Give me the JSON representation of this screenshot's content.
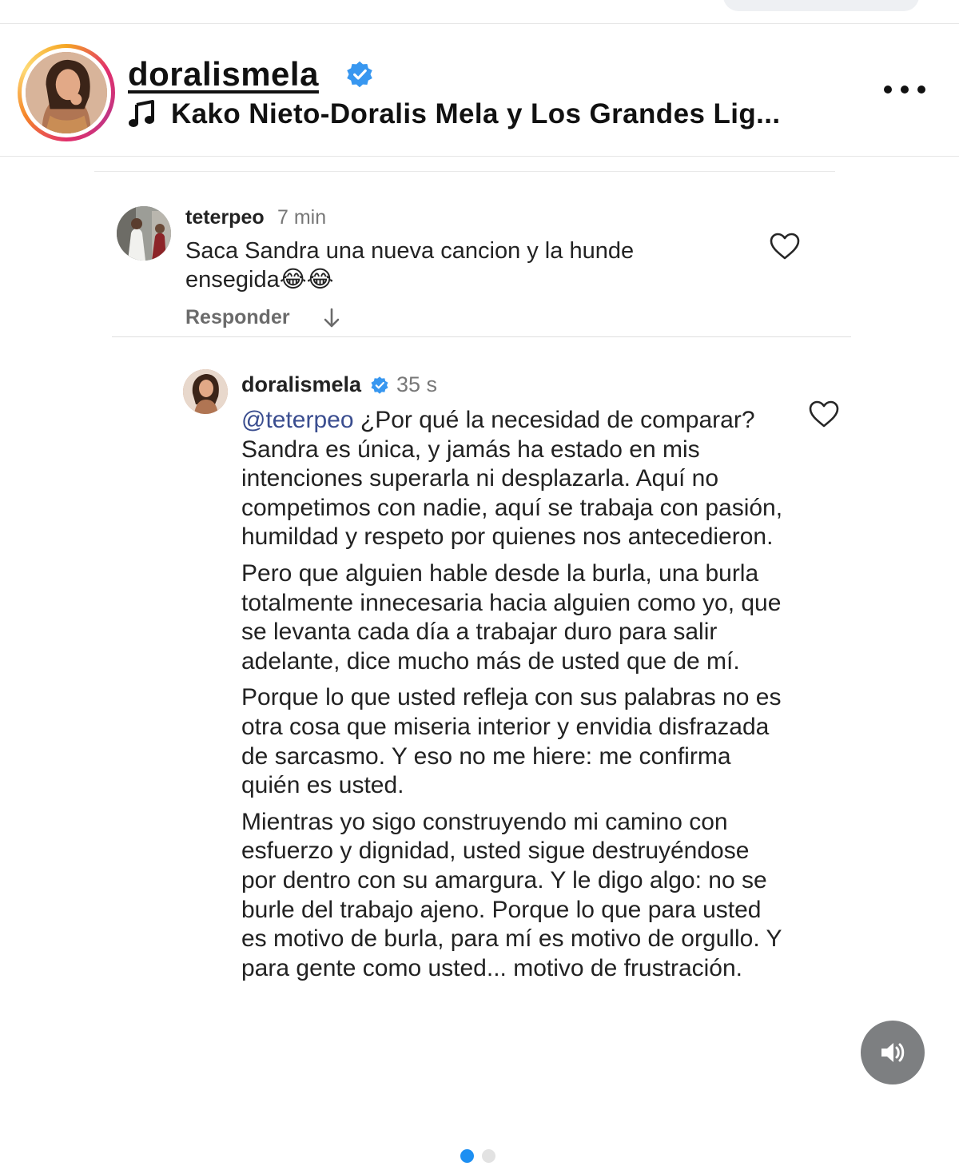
{
  "header": {
    "username": "doralismela",
    "verified": true,
    "audio_track": "Kako Nieto-Doralis Mela y Los Grandes Lig...",
    "more_icon": "more-horizontal-icon"
  },
  "comments": [
    {
      "username": "teterpeo",
      "time": "7 min",
      "text": "Saca Sandra una nueva cancion y la hunde ensegida😂😂",
      "reply_label": "Responder",
      "like_icon": "heart-outline-icon"
    },
    {
      "username": "doralismela",
      "verified": true,
      "time": "35 s",
      "mention": "@teterpeo",
      "paragraphs": [
        "¿Por qué la necesidad de comparar? Sandra es única, y jamás ha estado en mis intenciones superarla ni desplazarla. Aquí no competimos con nadie, aquí se trabaja con pasión, humildad y respeto por quienes nos antecedieron.",
        "Pero que alguien hable desde la burla, una burla totalmente innecesaria hacia alguien como yo, que se levanta cada día a trabajar duro para salir adelante, dice mucho más de usted que de mí.",
        "Porque lo que usted refleja con sus palabras no es otra cosa que miseria interior y envidia disfrazada de sarcasmo. Y eso no me hiere: me confirma quién es usted.",
        "Mientras yo sigo construyendo mi camino con esfuerzo y dignidad, usted sigue destruyéndose por dentro con su amargura. Y le digo algo: no se burle del trabajo ajeno. Porque lo que para usted es motivo de burla, para mí es motivo de orgullo. Y para gente como usted... motivo de frustración."
      ],
      "like_icon": "heart-outline-icon"
    }
  ],
  "controls": {
    "sound_icon": "speaker-volume-icon",
    "carousel_total": 2,
    "carousel_active": 1
  },
  "colors": {
    "verified_blue": "#3897f0",
    "mention": "#3a4d8f",
    "carousel_active": "#1d8ff2",
    "carousel_inactive": "#e2e2e2"
  }
}
